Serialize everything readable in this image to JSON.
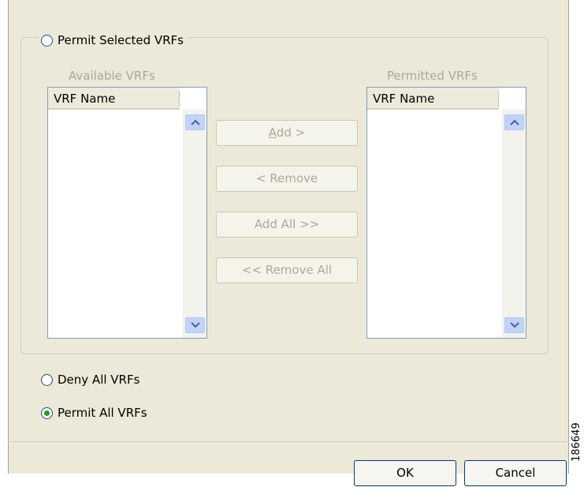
{
  "radios": {
    "permit_selected": {
      "label": "Permit Selected VRFs",
      "checked": false
    },
    "deny_all": {
      "label": "Deny All VRFs",
      "checked": false
    },
    "permit_all": {
      "label": "Permit All VRFs",
      "checked": true
    }
  },
  "available": {
    "caption": "Available VRFs",
    "column_header": "VRF Name",
    "items": []
  },
  "permitted": {
    "caption": "Permitted VRFs",
    "column_header": "VRF Name",
    "items": []
  },
  "buttons": {
    "add": {
      "mnemonic": "A",
      "rest": "dd >"
    },
    "remove": "< Remove",
    "add_all": "Add All >>",
    "remove_all": "<< Remove All",
    "ok": "OK",
    "cancel": "Cancel"
  },
  "figure_id": "186649",
  "colors": {
    "dialog_bg": "#ece9d8",
    "radio_dot": "#21a121",
    "disabled_text": "#aca899",
    "scroll_button": "#c1d3fb"
  },
  "icons": [
    "scroll-up-arrow-icon",
    "scroll-down-arrow-icon"
  ]
}
